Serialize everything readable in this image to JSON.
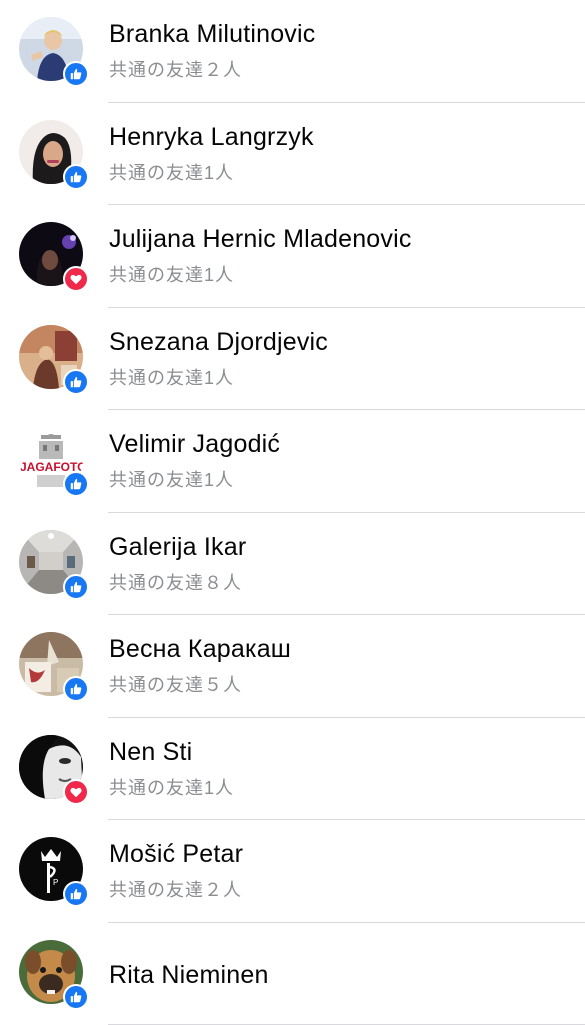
{
  "people": [
    {
      "name": "Branka Milutinovic",
      "mutual": "共通の友達２人",
      "reaction": "like",
      "reaction_icon": "thumbs-up-icon"
    },
    {
      "name": "Henryka Langrzyk",
      "mutual": "共通の友達1人",
      "reaction": "like",
      "reaction_icon": "thumbs-up-icon"
    },
    {
      "name": "Julijana Hernic Mladenovic",
      "mutual": "共通の友達1人",
      "reaction": "love",
      "reaction_icon": "heart-icon"
    },
    {
      "name": "Snezana Djordjevic",
      "mutual": "共通の友達1人",
      "reaction": "like",
      "reaction_icon": "thumbs-up-icon"
    },
    {
      "name": "Velimir Jagodić",
      "mutual": "共通の友達1人",
      "reaction": "like",
      "reaction_icon": "thumbs-up-icon"
    },
    {
      "name": "Galerija Ikar",
      "mutual": "共通の友達８人",
      "reaction": "like",
      "reaction_icon": "thumbs-up-icon"
    },
    {
      "name": "Весна Каракаш",
      "mutual": "共通の友達５人",
      "reaction": "like",
      "reaction_icon": "thumbs-up-icon"
    },
    {
      "name": "Nen Sti",
      "mutual": "共通の友達1人",
      "reaction": "love",
      "reaction_icon": "heart-icon"
    },
    {
      "name": "Mošić Petar",
      "mutual": "共通の友達２人",
      "reaction": "like",
      "reaction_icon": "thumbs-up-icon"
    },
    {
      "name": "Rita Nieminen",
      "reaction": "like",
      "reaction_icon": "thumbs-up-icon"
    }
  ],
  "colors": {
    "like": "#1877f2",
    "love": "#f0284a",
    "divider": "#d9d9dd",
    "name_text": "#050505",
    "secondary_text": "#8a8d91"
  }
}
